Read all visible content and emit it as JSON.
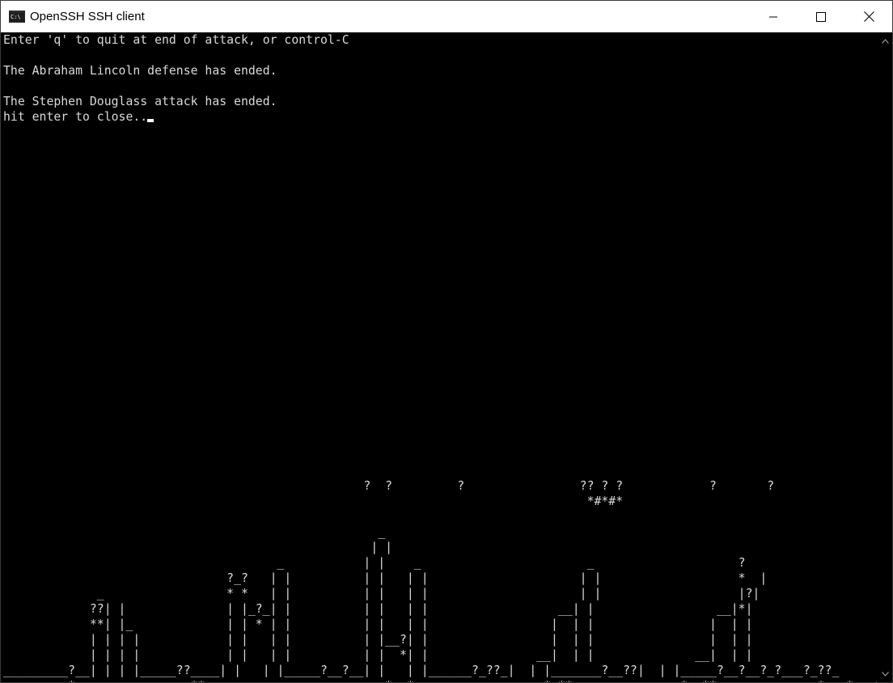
{
  "window": {
    "title": "OpenSSH SSH client",
    "icon": "console-icon",
    "icon_glyph": "C:\\",
    "controls": [
      "minimize-icon",
      "maximize-icon",
      "close-icon"
    ]
  },
  "colors": {
    "terminal_bg": "#000000",
    "terminal_fg": "#d9d9d9",
    "titlebar_bg": "#ffffff"
  },
  "terminal": {
    "line_0": "Enter 'q' to quit at end of attack, or control-C",
    "line_1": "",
    "line_2": "The Abraham Lincoln defense has ended.",
    "line_3": "",
    "line_4": "The Stephen Douglass attack has ended.",
    "line_5": "hit enter to close..",
    "line_29": "                                                  ?  ?         ?                ?? ? ?            ?       ?",
    "line_30": "                                                                                 *#*#*",
    "line_32": "                                                    _",
    "line_33": "                                                   | |",
    "line_34": "                                      _           | |    _                       _                    ?",
    "line_35": "                               ?_?   | |          | |   | |                     | |                   *  |",
    "line_36": "             _                 * *   | |          | |   | |                     | |                   |?|",
    "line_37": "            ??| |              | |_?_| |          | |   | |                  __| |                 __|*|",
    "line_38": "            **| |_             | | * | |          | |   | |                 |  | |                |  | |",
    "line_39": "            | | | |            | |   | |          | |__?| |                 |  | |                |  | |",
    "line_40": "            | | | |            | |   | |          | |  *| |               __|  | |              __|  | |",
    "line_41": "_________?__| | | |_____??____| |   | |_____?__?__| |   | |______?_??_|  | |_______?__??|  | |_____?__?__?_?___?_??_",
    "line_42": "         *                **                         *  *                  * **               *  **              *   *   * *   * **"
  }
}
